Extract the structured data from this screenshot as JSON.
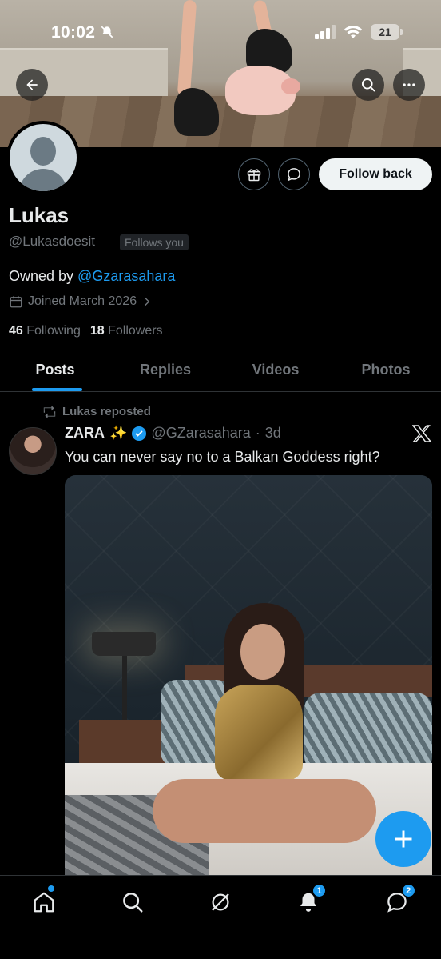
{
  "status_bar": {
    "time": "10:02",
    "battery": "21"
  },
  "profile": {
    "display_name": "Lukas",
    "handle": "@Lukasdoesit",
    "follows_you": "Follows you",
    "bio_prefix": "Owned by ",
    "bio_mention": "@Gzarasahara",
    "joined": "Joined March 2026",
    "following_count": "46",
    "following_label": "Following",
    "followers_count": "18",
    "followers_label": "Followers",
    "follow_button": "Follow back"
  },
  "tabs": [
    {
      "label": "Posts",
      "active": true
    },
    {
      "label": "Replies",
      "active": false
    },
    {
      "label": "Videos",
      "active": false
    },
    {
      "label": "Photos",
      "active": false
    }
  ],
  "post": {
    "repost_label": "Lukas reposted",
    "author_name": "ZARA",
    "author_emoji": "✨",
    "author_handle": "@GZarasahara",
    "separator": "·",
    "age": "3d",
    "text": "You can never say no to a Balkan Goddess right?"
  },
  "bottom_nav": {
    "notifications_badge": "1",
    "messages_badge": "2"
  },
  "colors": {
    "accent": "#1d9bf0",
    "background": "#000000",
    "muted_text": "#71767b",
    "primary_text": "#e7e9ea"
  }
}
